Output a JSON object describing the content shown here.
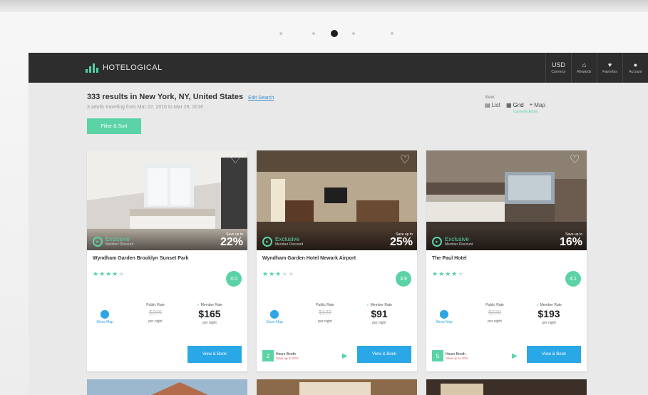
{
  "brand": {
    "name": "HOTELOGICAL"
  },
  "nav": [
    {
      "icon": "USD",
      "label": "Currency"
    },
    {
      "icon": "⌂",
      "label": "Rewards"
    },
    {
      "icon": "♥",
      "label": "Favorites"
    },
    {
      "icon": "●",
      "label": "Account"
    }
  ],
  "search": {
    "title": "333 results in New York, NY, United States",
    "edit_label": "Edit Search",
    "subtitle": "3 adults traveling from Mar 22, 2016 to Mar 28, 2016",
    "refine_label": "Filter & Sort"
  },
  "view": {
    "label": "View:",
    "options": [
      "List",
      "Grid",
      "Map"
    ],
    "selected_hint": "Currently Active"
  },
  "cards": [
    {
      "name": "Wyndham Garden Brooklyn Sunset Park",
      "stars": 4,
      "score": "4.0",
      "exclusive": "Exclusive",
      "exclusive_sub": "Member Discount",
      "save_label": "Save up to",
      "save_pct": "22%",
      "public_label": "Public Rate",
      "public_price": "$209",
      "per_night": "per night",
      "member_label": "Member Rate",
      "member_price": "$165",
      "map_label": "Show Map",
      "cta": "View & Book",
      "deal": null
    },
    {
      "name": "Wyndham Garden Hotel Newark Airport",
      "stars": 3,
      "score": "3.9",
      "exclusive": "Exclusive",
      "exclusive_sub": "Member Discount",
      "save_label": "Save up to",
      "save_pct": "25%",
      "public_label": "Public Rate",
      "public_price": "$122",
      "per_night": "per night",
      "member_label": "Member Rate",
      "member_price": "$91",
      "map_label": "Show Map",
      "cta": "View & Book",
      "deal": {
        "badge": "2",
        "title": "Hours Booth",
        "sub": "Save up to 20%"
      }
    },
    {
      "name": "The Paul Hotel",
      "stars": 4,
      "score": "4.1",
      "exclusive": "Exclusive",
      "exclusive_sub": "Member Discount",
      "save_label": "Save up to",
      "save_pct": "16%",
      "public_label": "Public Rate",
      "public_price": "$230",
      "per_night": "per night",
      "member_label": "Member Rate",
      "member_price": "$193",
      "map_label": "Show Map",
      "cta": "View & Book",
      "deal": {
        "badge": "5",
        "title": "Hours Booth",
        "sub": "Save up to 20%"
      }
    }
  ],
  "colors": {
    "accent": "#5bd3a6",
    "button": "#2aa7e6",
    "navbar": "#2d2d2d"
  }
}
